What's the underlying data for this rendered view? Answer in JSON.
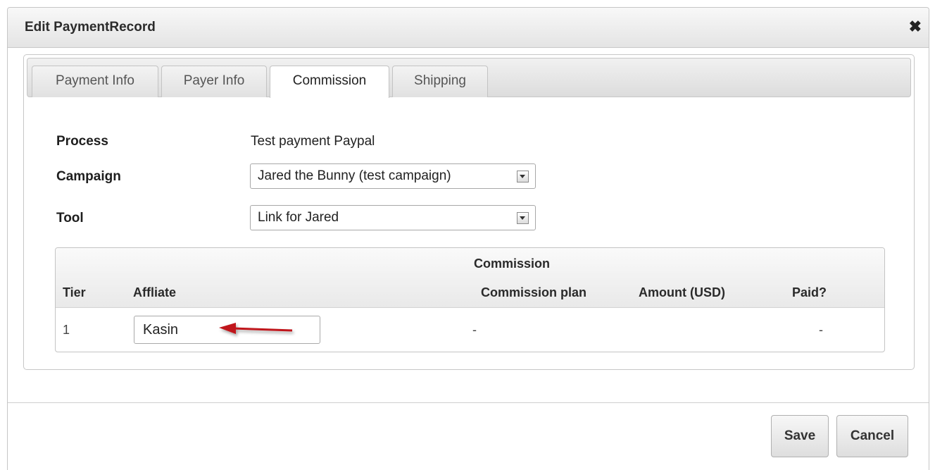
{
  "dialog": {
    "title": "Edit PaymentRecord",
    "close_glyph": "✖"
  },
  "tabs": [
    {
      "label": "Payment Info",
      "active": false
    },
    {
      "label": "Payer Info",
      "active": false
    },
    {
      "label": "Commission",
      "active": true
    },
    {
      "label": "Shipping",
      "active": false
    }
  ],
  "form": {
    "process_label": "Process",
    "process_value": "Test payment Paypal",
    "campaign_label": "Campaign",
    "campaign_value": "Jared the Bunny (test campaign)",
    "tool_label": "Tool",
    "tool_value": "Link for Jared"
  },
  "commission_table": {
    "group_header": "Commission",
    "columns": [
      "Tier",
      "Affliate",
      "Commission plan",
      "Amount (USD)",
      "Paid?"
    ],
    "rows": [
      {
        "tier": "1",
        "affiliate": "Kasin",
        "commission_plan": "-",
        "amount": "",
        "paid": "-"
      }
    ]
  },
  "annotation": {
    "arrow_color": "#c0161a"
  },
  "buttons": {
    "save": "Save",
    "cancel": "Cancel"
  }
}
